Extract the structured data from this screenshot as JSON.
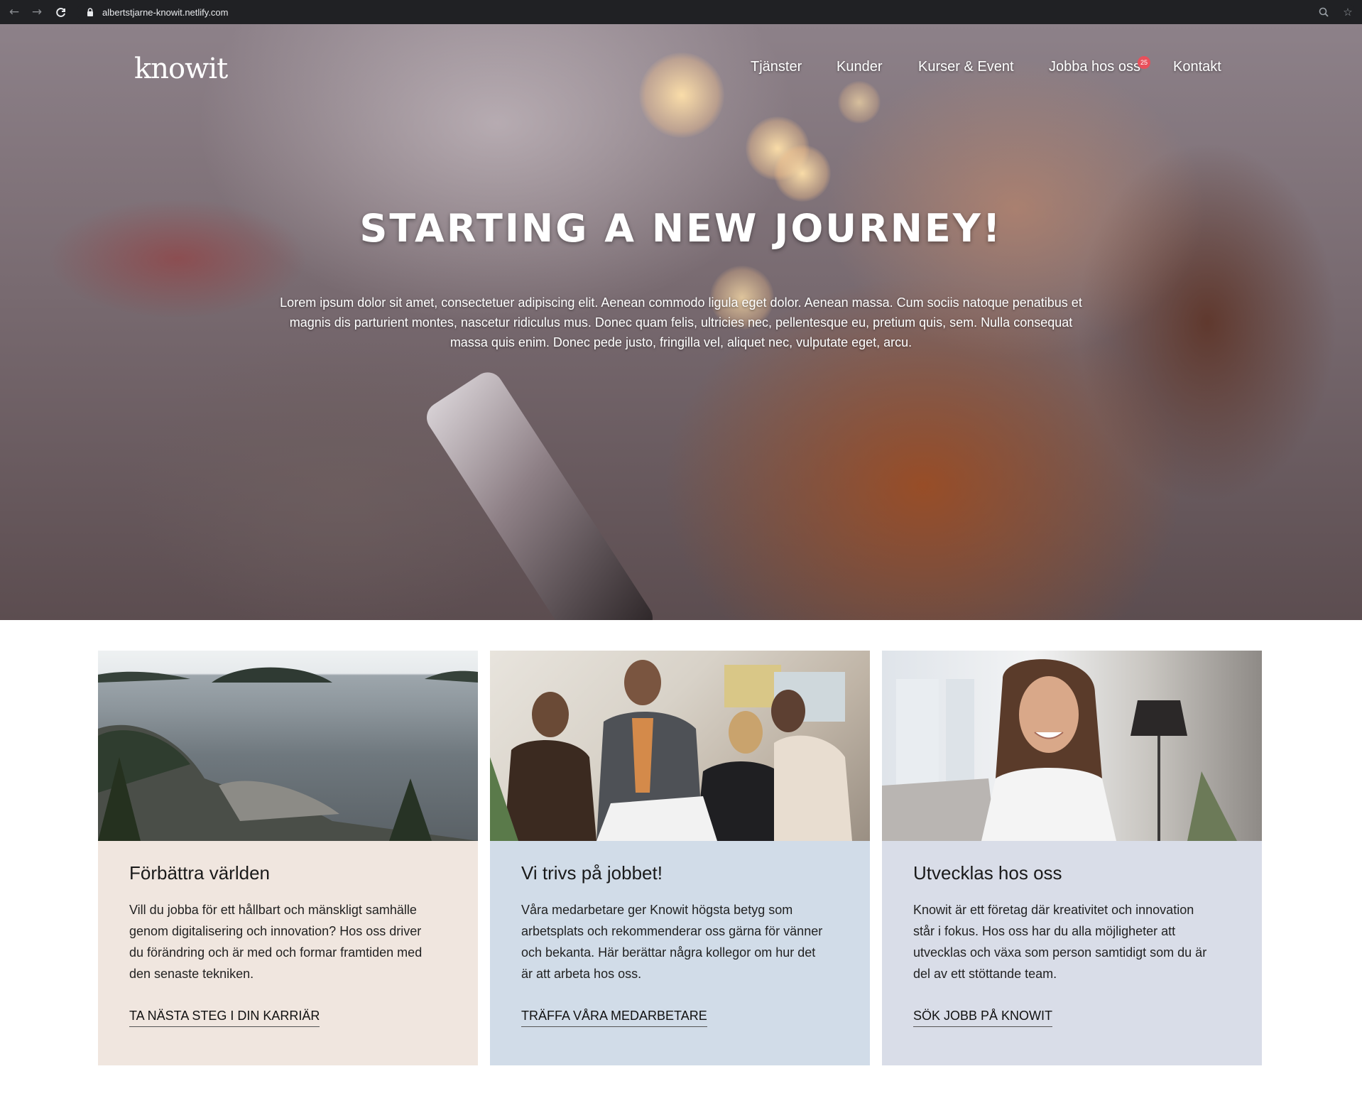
{
  "browser": {
    "url": "albertstjarne-knowit.netlify.com"
  },
  "header": {
    "logo": "knowit",
    "nav": [
      {
        "label": "Tjänster"
      },
      {
        "label": "Kunder"
      },
      {
        "label": "Kurser & Event"
      },
      {
        "label": "Jobba hos oss",
        "badge": "25"
      },
      {
        "label": "Kontakt"
      }
    ]
  },
  "hero": {
    "title": "STARTING A NEW JOURNEY!",
    "lead": "Lorem ipsum dolor sit amet, consectetuer adipiscing elit. Aenean commodo ligula eget dolor. Aenean massa. Cum sociis natoque penatibus et magnis dis parturient montes, nascetur ridiculus mus. Donec quam felis, ultricies nec, pellentesque eu, pretium quis, sem. Nulla consequat massa quis enim. Donec pede justo, fringilla vel, aliquet nec, vulputate eget, arcu."
  },
  "cards": [
    {
      "title": "Förbättra världen",
      "text": "Vill du jobba för ett hållbart och mänskligt samhälle genom digitalisering och innovation? Hos oss driver du förändring och är med och formar framtiden med den senaste tekniken.",
      "link": "TA NÄSTA STEG I DIN KARRIÄR",
      "bg": "#f0e6df"
    },
    {
      "title": "Vi trivs på jobbet!",
      "text": "Våra medarbetare ger Knowit högsta betyg som arbetsplats och rekommenderar oss gärna för vänner och bekanta. Här berättar några kollegor om hur det är att arbeta hos oss.",
      "link": "TRÄFFA VÅRA MEDARBETARE",
      "bg": "#d1dce8"
    },
    {
      "title": "Utvecklas hos oss",
      "text": "Knowit är ett företag där kreativitet och innovation står i fokus. Hos oss har du alla möjligheter att utvecklas och växa som person samtidigt som du är del av ett stöttande team.",
      "link": "SÖK JOBB PÅ KNOWIT",
      "bg": "#d9dde8"
    }
  ],
  "icons": {
    "back": "arrow-left-icon",
    "forward": "arrow-right-icon",
    "reload": "reload-icon",
    "lock": "lock-icon",
    "zoom": "magnifier-icon",
    "bookmark": "star-icon"
  }
}
